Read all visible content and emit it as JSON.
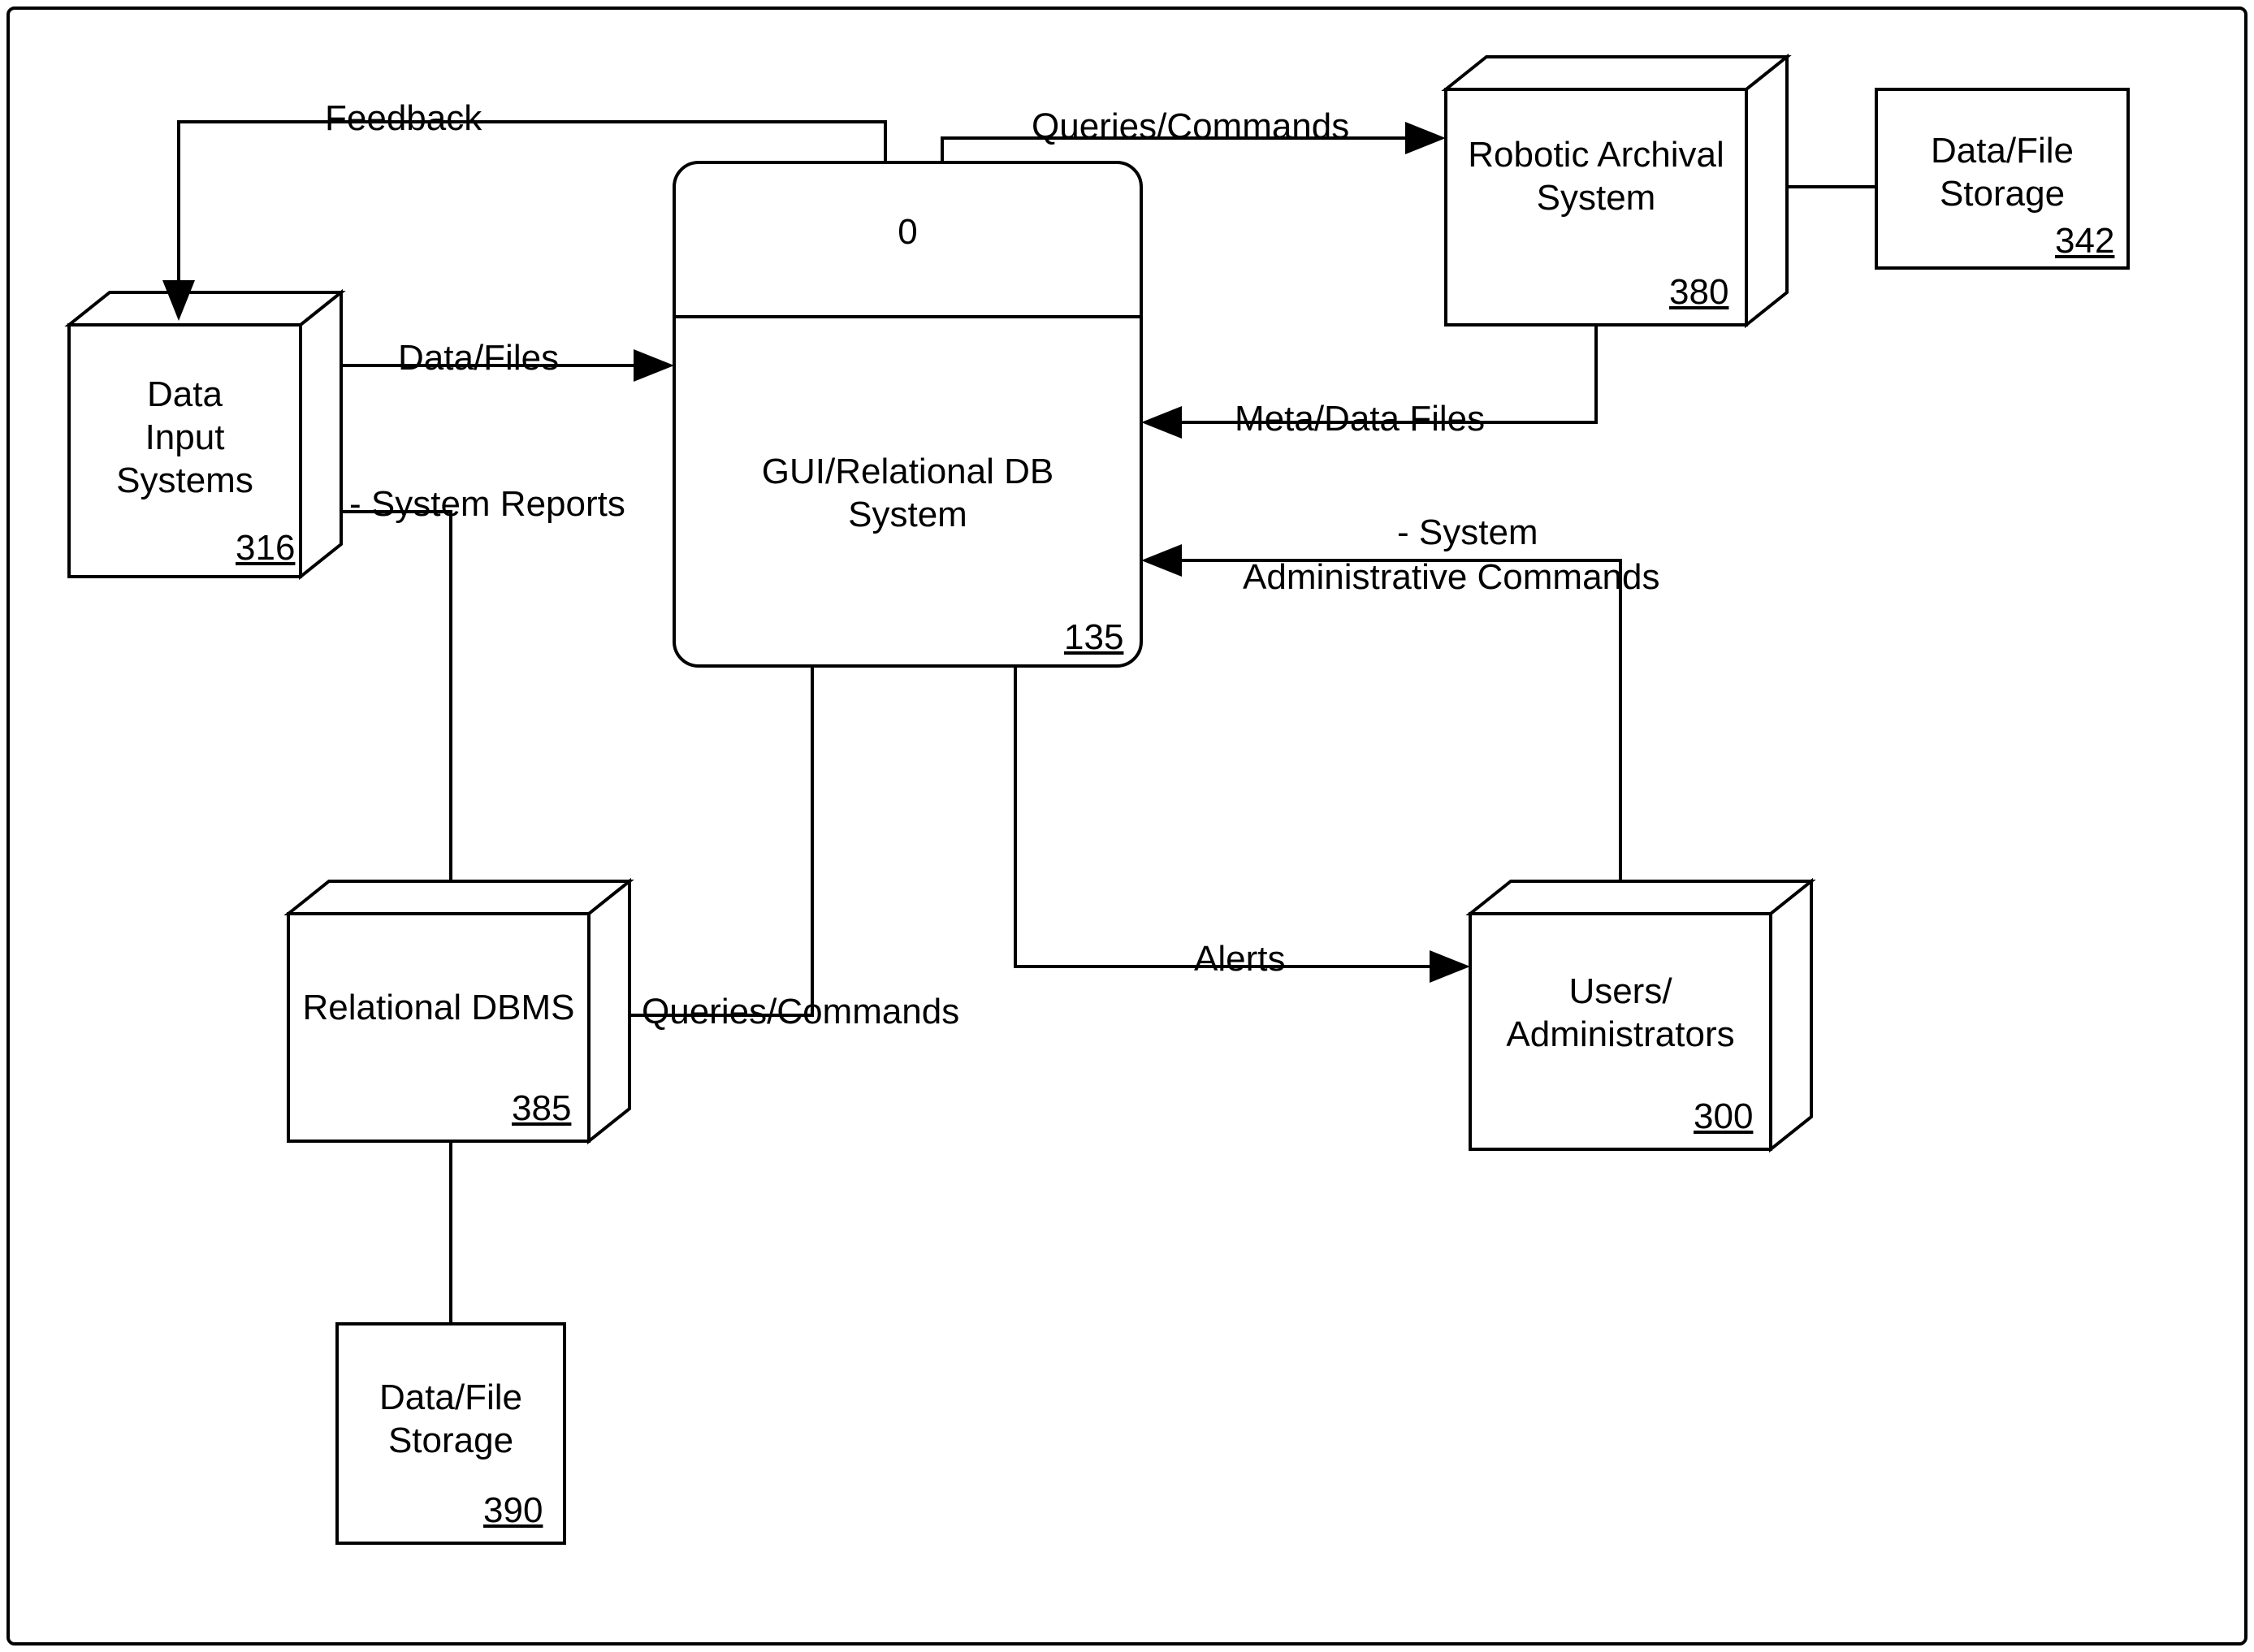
{
  "nodes": {
    "data_input_systems": {
      "label": "Data\nInput\nSystems",
      "ref": "316"
    },
    "gui_rel_db": {
      "header": "0",
      "label": "GUI/Relational DB\nSystem",
      "ref": "135"
    },
    "robotic_archival": {
      "label": "Robotic Archival\nSystem",
      "ref": "380"
    },
    "data_file_storage_top": {
      "label": "Data/File\nStorage",
      "ref": "342"
    },
    "relational_dbms": {
      "label": "Relational DBMS",
      "ref": "385"
    },
    "data_file_storage_bottom": {
      "label": "Data/File\nStorage",
      "ref": "390"
    },
    "users_admins": {
      "label": "Users/\nAdministrators",
      "ref": "300"
    }
  },
  "edges": {
    "feedback": "Feedback",
    "data_files": "Data/Files",
    "system_reports": "- System Reports",
    "queries_commands_top": "Queries/Commands",
    "meta_data_files": "Meta/Data Files",
    "system_admin_cmds_1": "- System",
    "system_admin_cmds_2": "Administrative Commands",
    "queries_commands_mid": "Queries/Commands",
    "alerts": "Alerts"
  }
}
